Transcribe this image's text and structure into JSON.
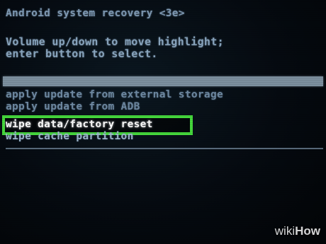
{
  "header": {
    "title": "Android system recovery <3e>",
    "instructions": [
      "Volume up/down to move highlight;",
      "enter button to select."
    ]
  },
  "menu": {
    "items": [
      {
        "label": "apply update from external storage",
        "state": "normal"
      },
      {
        "label": "apply update from ADB",
        "state": "normal"
      },
      {
        "label": "wipe data/factory reset",
        "state": "selected"
      },
      {
        "label": "wipe cache partition",
        "state": "normal"
      }
    ]
  },
  "annotation": {
    "highlight_color": "#45d83c"
  },
  "watermark": {
    "wiki": "wiki",
    "how": "How"
  },
  "colors": {
    "screen_background": "#050a10",
    "text": "#8aa6bf",
    "selected_text": "#ffffff"
  }
}
